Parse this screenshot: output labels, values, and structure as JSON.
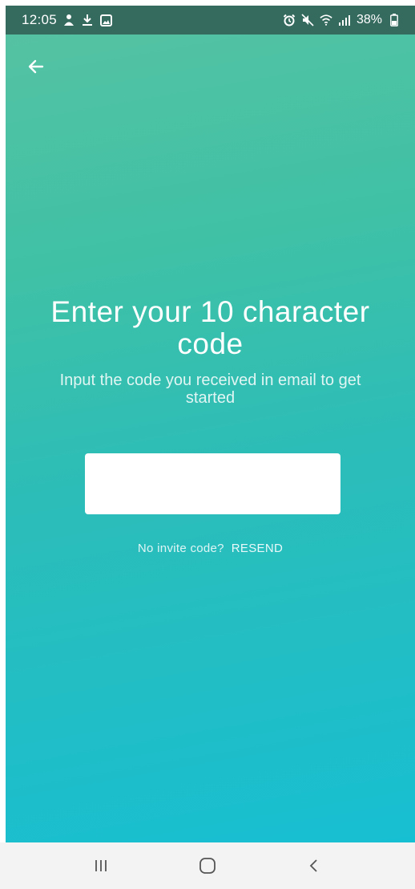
{
  "status_bar": {
    "time": "12:05",
    "battery": "38%",
    "left_icons": [
      "notification-app-icon",
      "download-icon",
      "gallery-icon"
    ],
    "right_icons": [
      "alarm-icon",
      "mute-icon",
      "wifi-icon",
      "signal-icon",
      "battery-icon"
    ]
  },
  "header": {
    "back_icon": "arrow-left-icon"
  },
  "main": {
    "title": "Enter your 10 character code",
    "subtitle": "Input the code you received in email to get started",
    "code_input": {
      "value": "",
      "placeholder": ""
    },
    "resend_prompt": "No invite code?",
    "resend_link": "RESEND"
  },
  "nav_bar": {
    "buttons": [
      "recent-apps-icon",
      "home-icon",
      "back-icon"
    ]
  },
  "colors": {
    "status_bar_bg": "#356a5e",
    "gradient_top": "#57c2a2",
    "gradient_bottom": "#17bfd2",
    "nav_bar_bg": "#f3f3f3"
  }
}
